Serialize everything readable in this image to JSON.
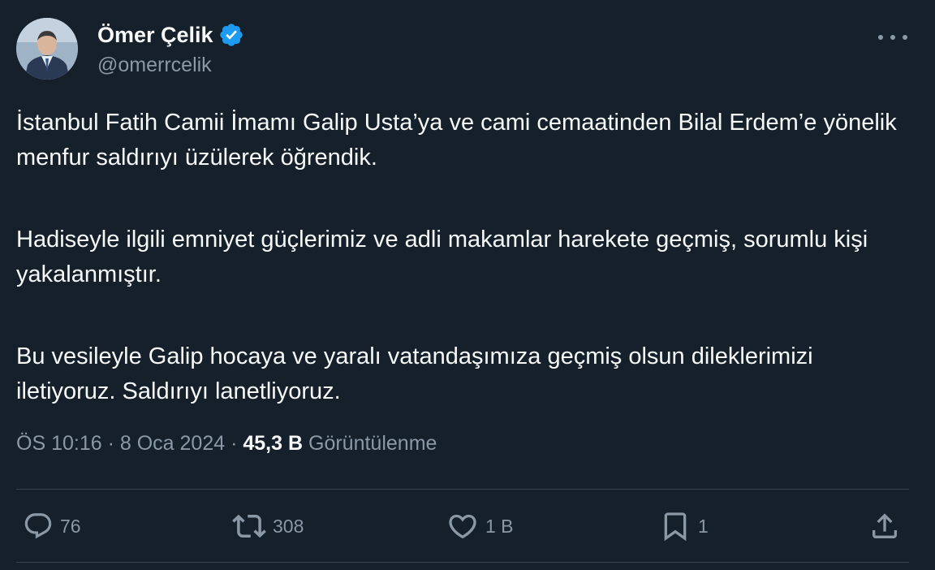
{
  "author": {
    "display_name": "Ömer Çelik",
    "handle": "@omerrcelik",
    "verified": true,
    "avatar_icon": "profile-photo"
  },
  "tweet": {
    "paragraphs": [
      "İstanbul Fatih Camii İmamı Galip Usta’ya ve cami cemaatinden Bilal Erdem’e yönelik menfur saldırıyı üzülerek öğrendik.",
      "Hadiseyle ilgili emniyet güçlerimiz ve adli makamlar harekete geçmiş, sorumlu kişi yakalanmıştır.",
      "Bu vesileyle Galip hocaya ve yaralı vatandaşımıza geçmiş olsun dileklerimizi iletiyoruz. Saldırıyı lanetliyoruz."
    ]
  },
  "meta": {
    "time": "ÖS 10:16",
    "separator": "·",
    "date": "8 Oca 2024",
    "views_count": "45,3 B",
    "views_label": "Görüntülenme"
  },
  "actions": {
    "reply": {
      "icon": "reply-icon",
      "count": "76"
    },
    "retweet": {
      "icon": "retweet-icon",
      "count": "308"
    },
    "like": {
      "icon": "heart-icon",
      "count": "1 B"
    },
    "bookmark": {
      "icon": "bookmark-icon",
      "count": "1"
    },
    "share": {
      "icon": "share-icon"
    }
  },
  "colors": {
    "background": "#15202b",
    "text": "#f7f9f9",
    "secondary_text": "#8b98a5",
    "verified_badge": "#1d9bf0",
    "divider": "#38444d"
  }
}
